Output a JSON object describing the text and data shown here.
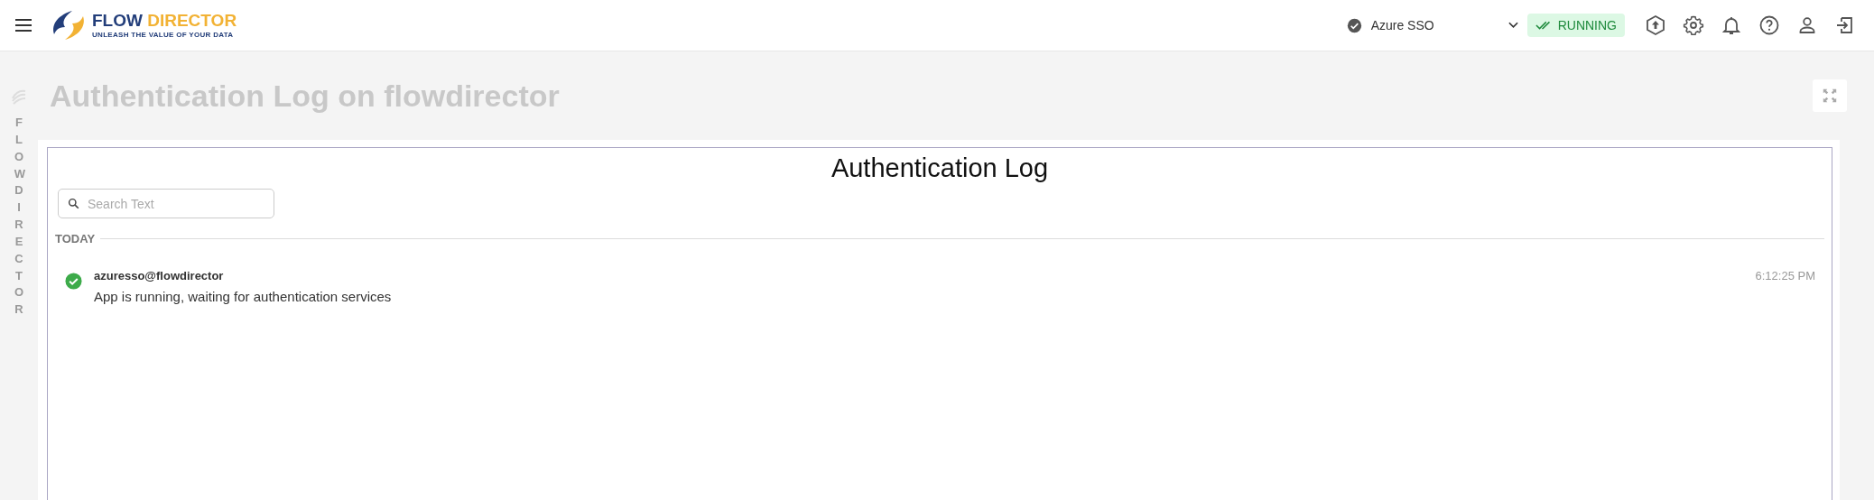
{
  "header": {
    "logo": {
      "word_1": "FLOW",
      "word_2": "DIRECTOR",
      "tagline": "UNLEASH THE VALUE OF YOUR DATA"
    },
    "provider": "Azure SSO",
    "status": {
      "label": "RUNNING",
      "running": true
    }
  },
  "sidebar": {
    "label": "FLOWDIRECTOR"
  },
  "page": {
    "title": "Authentication Log on flowdirector"
  },
  "panel": {
    "title": "Authentication Log",
    "search": {
      "placeholder": "Search Text"
    },
    "groups": [
      {
        "label": "TODAY",
        "entries": [
          {
            "user": "azuresso@flowdirector",
            "message": "App is running, waiting for authentication services",
            "time": "6:12:25 PM",
            "success": true
          }
        ]
      }
    ]
  }
}
